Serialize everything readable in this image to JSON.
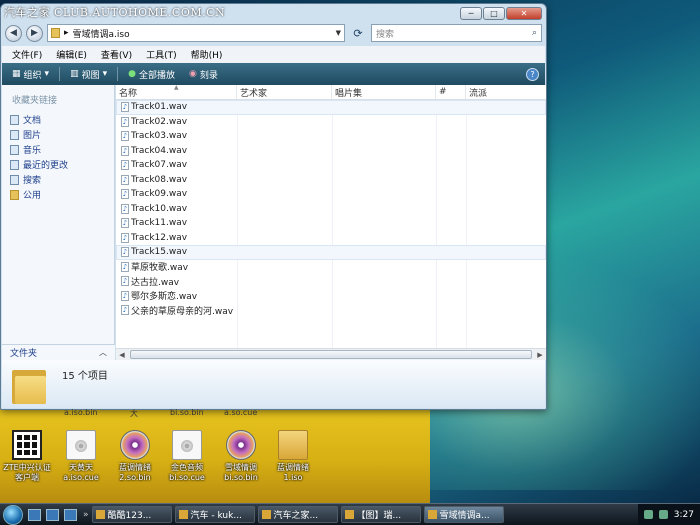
{
  "watermark": "汽车之家 CLUB.AUTOHOME.COM.CN",
  "window": {
    "controls": {
      "minimize": "─",
      "maximize": "□",
      "close": "✕"
    },
    "address": {
      "folder_name": "雪域情调a.iso"
    },
    "search_placeholder": "搜索",
    "menu": [
      "文件(F)",
      "编辑(E)",
      "查看(V)",
      "工具(T)",
      "帮助(H)"
    ],
    "toolbar": {
      "organize": "组织",
      "views": "视图",
      "play_all": "全部播放",
      "burn": "刻录"
    },
    "nav_pane": {
      "title": "收藏夹链接",
      "items": [
        "文档",
        "图片",
        "音乐",
        "最近的更改",
        "搜索",
        "公用"
      ],
      "footer": "文件夹"
    },
    "columns": [
      "名称",
      "艺术家",
      "唱片集",
      "#",
      "流派"
    ],
    "files": [
      "Track01.wav",
      "Track02.wav",
      "Track03.wav",
      "Track04.wav",
      "Track07.wav",
      "Track08.wav",
      "Track09.wav",
      "Track10.wav",
      "Track11.wav",
      "Track12.wav",
      "Track15.wav",
      "草原牧歌.wav",
      "达古拉.wav",
      "鄂尔多斯恋.wav",
      "父亲的草原母亲的河.wav"
    ],
    "details": {
      "item_count": "15 个项目"
    }
  },
  "desktop": {
    "partial_labels": [
      "a.iso.bin",
      "大",
      "bi.so.bin",
      "a.so.cue"
    ],
    "icons": [
      {
        "icon": "qr-code-icon",
        "label": "ZTE中兴认证客户端"
      },
      {
        "icon": "file-cue-icon",
        "label": "天黄天\na.iso.cue"
      },
      {
        "icon": "disc-icon",
        "label": "蓝调情绪\n2.so.bin"
      },
      {
        "icon": "file-cue-icon",
        "label": "金色音频\nbi.so.cue"
      },
      {
        "icon": "disc-icon",
        "label": "雪域情调\nbi.so.bin"
      },
      {
        "icon": "folder-icon",
        "label": "蓝调情绪\n1.iso"
      }
    ]
  },
  "taskbar": {
    "buttons": [
      "酷酷123...",
      "汽车 - kuk...",
      "汽车之家...",
      "【图】瑞...",
      "雪域情调a..."
    ],
    "tray_text": "3:27"
  },
  "colors": {
    "toolbar": "#2c5f77",
    "link_text": "#1f3f8c",
    "wallpaper_yellow": "#e0bc1a"
  }
}
